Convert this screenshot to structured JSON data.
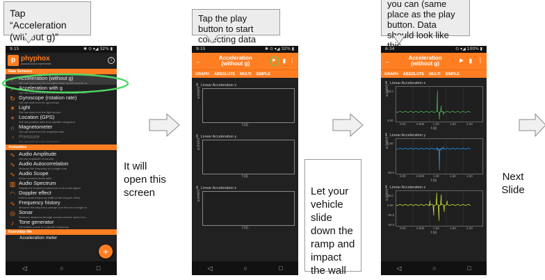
{
  "callouts": {
    "step1": "Tap “Acceleration (without g)”",
    "step2": "Tap the play button to start collecting data",
    "step3": "you can (same place as the play button. Data should look like this"
  },
  "textboxes": {
    "open_screen": "It will open this screen",
    "vehicle": "Let your vehicle slide down the ramp and impact the wall",
    "next_slide": "Next Slide"
  },
  "phone1": {
    "status_time": "9:15",
    "status_right": "✱ ⊙ ▾◢ 32% ▮",
    "app_name": "phyphox",
    "app_sub": "physical phone experiments",
    "cat_raw": "Raw Sensors",
    "cat_acoustics": "Acoustics",
    "cat_everyday": "Everyday life",
    "sensors": [
      {
        "icon": "acceleration-icon",
        "glyph": "↗",
        "name": "Acceleration (without g)",
        "desc": "Get raw data from the so-called linear accelerometer, w..."
      },
      {
        "icon": "acceleration-g-icon",
        "glyph": "↗",
        "name": "Acceleration with g",
        "desc": "Get raw data from the accelerometer. This sensor will n..."
      },
      {
        "icon": "gyroscope-icon",
        "glyph": "↻",
        "name": "Gyroscope (rotation rate)",
        "desc": "Get raw data from the gyroscope."
      },
      {
        "icon": "light-icon",
        "glyph": "☀",
        "name": "Light",
        "desc": "Get raw data from the light sensor."
      },
      {
        "icon": "location-icon",
        "glyph": "⌖",
        "name": "Location (GPS)",
        "desc": "Get raw position data from satellite navigation."
      },
      {
        "icon": "magnet-icon",
        "glyph": "∩",
        "name": "Magnetometer",
        "desc": "Get raw data from the magnetometer."
      },
      {
        "icon": "pressure-icon",
        "glyph": "◔",
        "name": "Pressure",
        "desc": "Get raw data from the barometer."
      }
    ],
    "acoustics": [
      {
        "icon": "amplitude-icon",
        "glyph": "∿",
        "name": "Audio Amplitude",
        "desc": "Get the amplitude of sounds."
      },
      {
        "icon": "autocorrelation-icon",
        "glyph": "∿",
        "name": "Audio Autocorrelation",
        "desc": "Measure the frequency of a single tone."
      },
      {
        "icon": "scope-icon",
        "glyph": "∿",
        "name": "Audio Scope",
        "desc": "Show recorded audio data."
      },
      {
        "icon": "spectrum-icon",
        "glyph": "▥",
        "name": "Audio Spectrum",
        "desc": "Display the frequency spectrum of an audio signal."
      },
      {
        "icon": "doppler-icon",
        "glyph": "◠",
        "name": "Doppler effect",
        "desc": "Detect small frequency shifts of the Doppler effect."
      },
      {
        "icon": "frequency-history-icon",
        "glyph": "∿",
        "name": "Frequency history",
        "desc": "Measure the frequency change over time for a single to..."
      },
      {
        "icon": "sonar-icon",
        "glyph": "◎",
        "name": "Sonar",
        "desc": "Measure distances through echoes and the speed of s..."
      },
      {
        "icon": "tone-icon",
        "glyph": "♪",
        "name": "Tone generator",
        "desc": "Generates a tone of a specific frequency."
      }
    ],
    "everyday_item": "Acceleration meter",
    "fab": "+"
  },
  "phone2": {
    "status_time": "9:15",
    "status_right": "✱ ⊙ ▾◢ 32% ▮",
    "title_line1": "Acceleration",
    "title_line2": "(without g)",
    "tabs": [
      "GRAPH",
      "ABSOLUTE",
      "MULTI",
      "SIMPLE"
    ],
    "graphs": [
      {
        "title": "Linear Acceleration x",
        "ylabel": "a (m/s²)",
        "unit": "t (s)"
      },
      {
        "title": "Linear Acceleration y",
        "ylabel": "a (m/s²)",
        "unit": "t (s)"
      },
      {
        "title": "Linear Acceleration z",
        "ylabel": "a (m/s²)",
        "unit": "t (s)"
      }
    ]
  },
  "phone3": {
    "status_time": "6:34",
    "status_right": "⊙ ▾◢ 100% ▮",
    "title_line1": "Acceleration",
    "title_line2": "(without g)",
    "tabs": [
      "GRAPH",
      "ABSOLUTE",
      "MULTI",
      "SIMPLE"
    ],
    "graphs": [
      {
        "title": "Linear Acceleration x",
        "ylabel": "a (m/s²)",
        "unit": "t (s)",
        "color": "#4caf50",
        "yticks": [
          "50.0",
          "0.00"
        ]
      },
      {
        "title": "Linear Acceleration y",
        "ylabel": "a (m/s²)",
        "unit": "t (s)",
        "color": "#2196f3",
        "yticks": [
          "0.00",
          "-50.0"
        ]
      },
      {
        "title": "Linear Acceleration z",
        "ylabel": "a (m/s²)",
        "unit": "t (s)",
        "color": "#cddc39",
        "yticks": [
          "20.0",
          "0.00",
          "-20.0",
          "-40.0"
        ]
      }
    ],
    "xticks": [
      "0.00",
      "0.500",
      "1.00",
      "1.50",
      "2.00"
    ]
  },
  "colors": {
    "accent": "#ff7e22",
    "highlight": "#4cd964"
  }
}
